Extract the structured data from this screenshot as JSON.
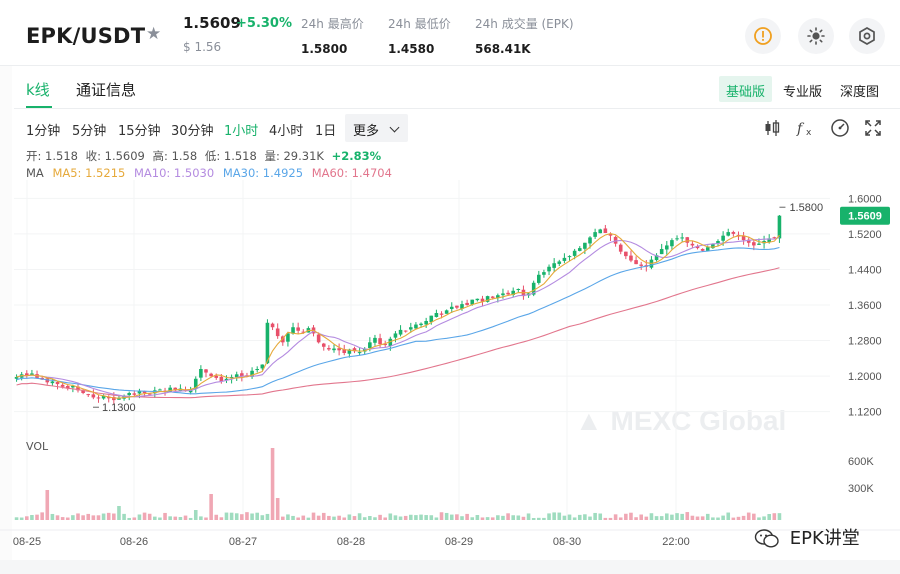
{
  "header": {
    "pair": "EPK/USDT",
    "last_price": "1.5609",
    "change_pct": "+5.30%",
    "price_usd": "$ 1.56",
    "stats": [
      {
        "label": "24h 最高价",
        "value": "1.5800"
      },
      {
        "label": "24h 最低价",
        "value": "1.4580"
      },
      {
        "label": "24h 成交量 (EPK)",
        "value": "568.41K"
      }
    ],
    "icons": [
      "info-icon",
      "brightness-icon",
      "settings-icon"
    ]
  },
  "tabs": {
    "kline": "k线",
    "info": "通证信息"
  },
  "versions": [
    "基础版",
    "专业版",
    "深度图"
  ],
  "intervals": [
    "1分钟",
    "5分钟",
    "15分钟",
    "30分钟",
    "1小时",
    "4小时",
    "1日"
  ],
  "active_interval": "1小时",
  "more_label": "更多",
  "ohlc": {
    "open": "开: 1.518",
    "close": "收: 1.5609",
    "high": "高: 1.58",
    "low": "低: 1.518",
    "vol": "量: 29.31K",
    "pct": "+2.83%"
  },
  "ma": {
    "label": "MA",
    "ma5": "MA5: 1.5215",
    "ma10": "MA10: 1.5030",
    "ma30": "MA30: 1.4925",
    "ma60": "MA60: 1.4704"
  },
  "colors": {
    "up": "#18b26b",
    "down": "#e8506a",
    "ma5": "#e6a93a",
    "ma10": "#b48be0",
    "ma30": "#5aa6e8",
    "ma60": "#e2768d"
  },
  "vol_label": "VOL",
  "watermark": "EPK讲堂",
  "chart_data": {
    "type": "candlestick",
    "y_ticks": [
      "1.6000",
      "1.5200",
      "1.4400",
      "1.3600",
      "1.2800",
      "1.2000",
      "1.1200"
    ],
    "ylim": [
      1.09,
      1.63
    ],
    "vol_ticks": [
      "600K",
      "300K"
    ],
    "x_ticks": [
      "08-25",
      "08-26",
      "08-27",
      "08-28",
      "08-29",
      "08-30",
      "22:00"
    ],
    "current_price_tag": "1.5609",
    "high_marker": "1.5800",
    "low_marker": "1.1300",
    "series": [
      {
        "name": "candles",
        "values": [
          1.198,
          1.204,
          1.201,
          1.206,
          1.196,
          1.192,
          1.186,
          1.188,
          1.182,
          1.176,
          1.172,
          1.178,
          1.168,
          1.162,
          1.158,
          1.152,
          1.15,
          1.156,
          1.15,
          1.146,
          1.15,
          1.156,
          1.162,
          1.158,
          1.166,
          1.162,
          1.16,
          1.168,
          1.17,
          1.166,
          1.174,
          1.168,
          1.172,
          1.166,
          1.17,
          1.194,
          1.216,
          1.208,
          1.2,
          1.196,
          1.188,
          1.194,
          1.198,
          1.204,
          1.2,
          1.198,
          1.212,
          1.216,
          1.226,
          1.32,
          1.31,
          1.29,
          1.276,
          1.296,
          1.31,
          1.302,
          1.298,
          1.308,
          1.296,
          1.276,
          1.266,
          1.26,
          1.262,
          1.258,
          1.252,
          1.26,
          1.256,
          1.254,
          1.262,
          1.276,
          1.286,
          1.272,
          1.27,
          1.284,
          1.296,
          1.304,
          1.302,
          1.31,
          1.316,
          1.318,
          1.324,
          1.336,
          1.342,
          1.338,
          1.348,
          1.356,
          1.354,
          1.362,
          1.36,
          1.372,
          1.374,
          1.368,
          1.38,
          1.376,
          1.382,
          1.386,
          1.384,
          1.392,
          1.396,
          1.38,
          1.386,
          1.41,
          1.428,
          1.434,
          1.446,
          1.454,
          1.458,
          1.466,
          1.47,
          1.482,
          1.488,
          1.5,
          1.512,
          1.524,
          1.53,
          1.522,
          1.516,
          1.498,
          1.48,
          1.47,
          1.46,
          1.452,
          1.448,
          1.446,
          1.462,
          1.472,
          1.486,
          1.494,
          1.506,
          1.51,
          1.512,
          1.5,
          1.494,
          1.488,
          1.482,
          1.49,
          1.498,
          1.504,
          1.516,
          1.524,
          1.52,
          1.514,
          1.506,
          1.5,
          1.494,
          1.498,
          1.504,
          1.51,
          1.512,
          1.561
        ]
      }
    ]
  }
}
